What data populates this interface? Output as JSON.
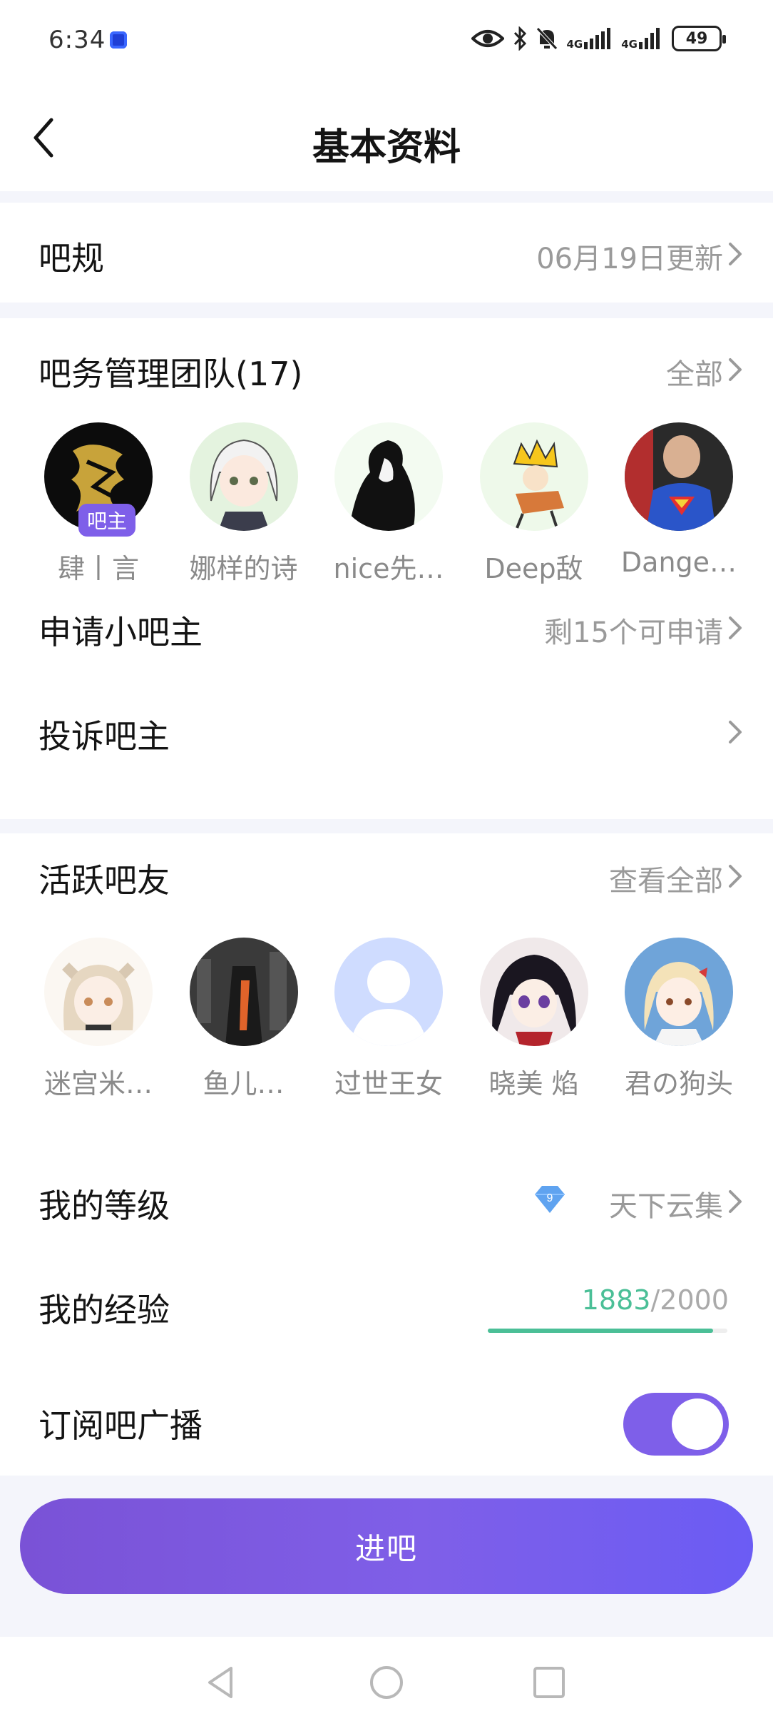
{
  "status_bar": {
    "time": "6:34",
    "battery": "49",
    "signal_1": "4G",
    "signal_2": "4G"
  },
  "header": {
    "title": "基本资料"
  },
  "rules": {
    "label": "吧规",
    "value": "06月19日更新"
  },
  "team": {
    "label": "吧务管理团队(17)",
    "action": "全部",
    "owner_badge": "吧主",
    "members": [
      {
        "name": "肆丨言"
      },
      {
        "name": "娜样的诗"
      },
      {
        "name": "nice先…"
      },
      {
        "name": "Deep敌"
      },
      {
        "name": "Dange…"
      }
    ]
  },
  "apply": {
    "label": "申请小吧主",
    "value": "剩15个可申请"
  },
  "complain": {
    "label": "投诉吧主"
  },
  "active": {
    "label": "活跃吧友",
    "action": "查看全部",
    "members": [
      {
        "name": "迷宫米…"
      },
      {
        "name": "鱼儿…"
      },
      {
        "name": "过世王女"
      },
      {
        "name": "晓美 焰"
      },
      {
        "name": "君の狗头"
      }
    ]
  },
  "level": {
    "label": "我的等级",
    "badge_number": "9",
    "value": "天下云集"
  },
  "experience": {
    "label": "我的经验",
    "current": "1883",
    "separator": "/",
    "total": "2000",
    "progress": 0.9415
  },
  "subscribe": {
    "label": "订阅吧广播",
    "enabled": true
  },
  "enter_button": {
    "label": "进吧"
  },
  "colors": {
    "accent": "#7e5fe9",
    "progress": "#4bbf97",
    "muted": "#9a9a9a"
  },
  "icons": [
    "back-icon",
    "chevron-right-icon",
    "eye-icon",
    "bluetooth-icon",
    "bell-muted-icon",
    "signal-icon",
    "battery-icon",
    "level-gem-icon",
    "nav-back-icon",
    "nav-home-icon",
    "nav-recents-icon"
  ]
}
